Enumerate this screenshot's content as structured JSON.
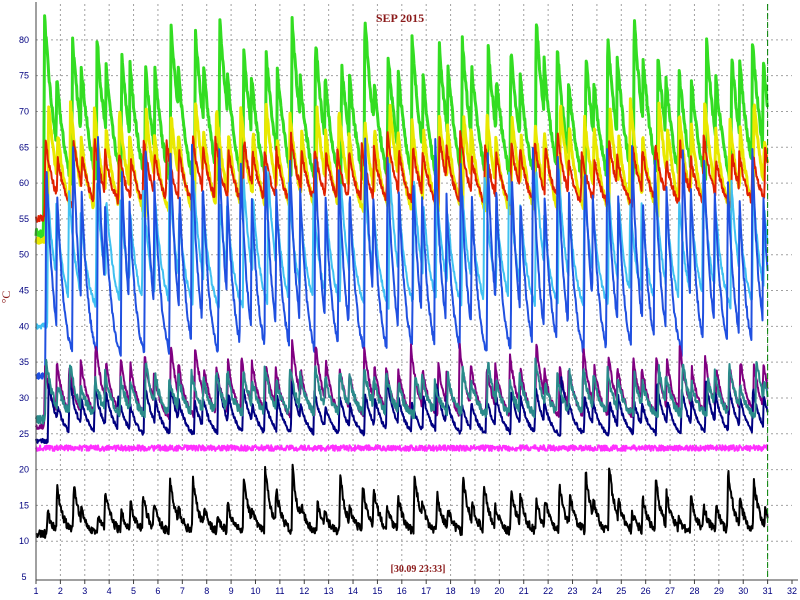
{
  "chart_data": {
    "type": "line",
    "title": "SEP 2015",
    "ylabel": "°C",
    "xlabel": "",
    "timestamp": "[30.09 23:33]",
    "xlim": [
      1,
      32
    ],
    "ylim": [
      5,
      85
    ],
    "x_ticks": [
      1,
      2,
      3,
      4,
      5,
      6,
      7,
      8,
      9,
      10,
      11,
      12,
      13,
      14,
      15,
      16,
      17,
      18,
      19,
      20,
      21,
      22,
      23,
      24,
      25,
      26,
      27,
      28,
      29,
      30,
      31,
      32
    ],
    "y_ticks": [
      5,
      10,
      15,
      20,
      25,
      30,
      35,
      40,
      45,
      50,
      55,
      60,
      65,
      70,
      75,
      80
    ],
    "grid": true,
    "cursor_x": 31,
    "colors": {
      "title": "#8b1a1a",
      "axis_text": "#000080",
      "grid": "#a0a0a0",
      "cursor": "#008000"
    },
    "series": [
      {
        "color": "#33dd22",
        "base": 53,
        "peak": 80,
        "vary": 4,
        "decay": 0.55,
        "noise": 0.6
      },
      {
        "color": "#e8e800",
        "base": 52,
        "peak": 70,
        "vary": 2,
        "decay": 0.45,
        "noise": 0.4
      },
      {
        "color": "#e02000",
        "base": 55,
        "peak": 66,
        "vary": 2,
        "decay": 0.4,
        "noise": 0.5
      },
      {
        "color": "#40c0f0",
        "base": 40,
        "peak": 60,
        "vary": 3,
        "decay": 0.35,
        "noise": 0.4
      },
      {
        "color": "#2050e0",
        "base": 33,
        "peak": 64,
        "vary": 3,
        "decay": 0.3,
        "noise": 0.5
      },
      {
        "color": "#800080",
        "base": 26,
        "peak": 36,
        "vary": 2,
        "decay": 0.35,
        "noise": 0.4
      },
      {
        "color": "#000080",
        "base": 24,
        "peak": 31,
        "vary": 2,
        "decay": 0.35,
        "noise": 0.3
      },
      {
        "color": "#2a8a8a",
        "base": 27,
        "peak": 34,
        "vary": 2,
        "decay": 0.3,
        "noise": 0.6
      },
      {
        "color": "#ff30ff",
        "base": 23,
        "peak": 23,
        "vary": 0,
        "decay": 1.0,
        "noise": 0.4
      },
      {
        "color": "#000000",
        "base": 11,
        "peak": 17,
        "vary": 4,
        "decay": 0.25,
        "noise": 0.6
      }
    ]
  }
}
